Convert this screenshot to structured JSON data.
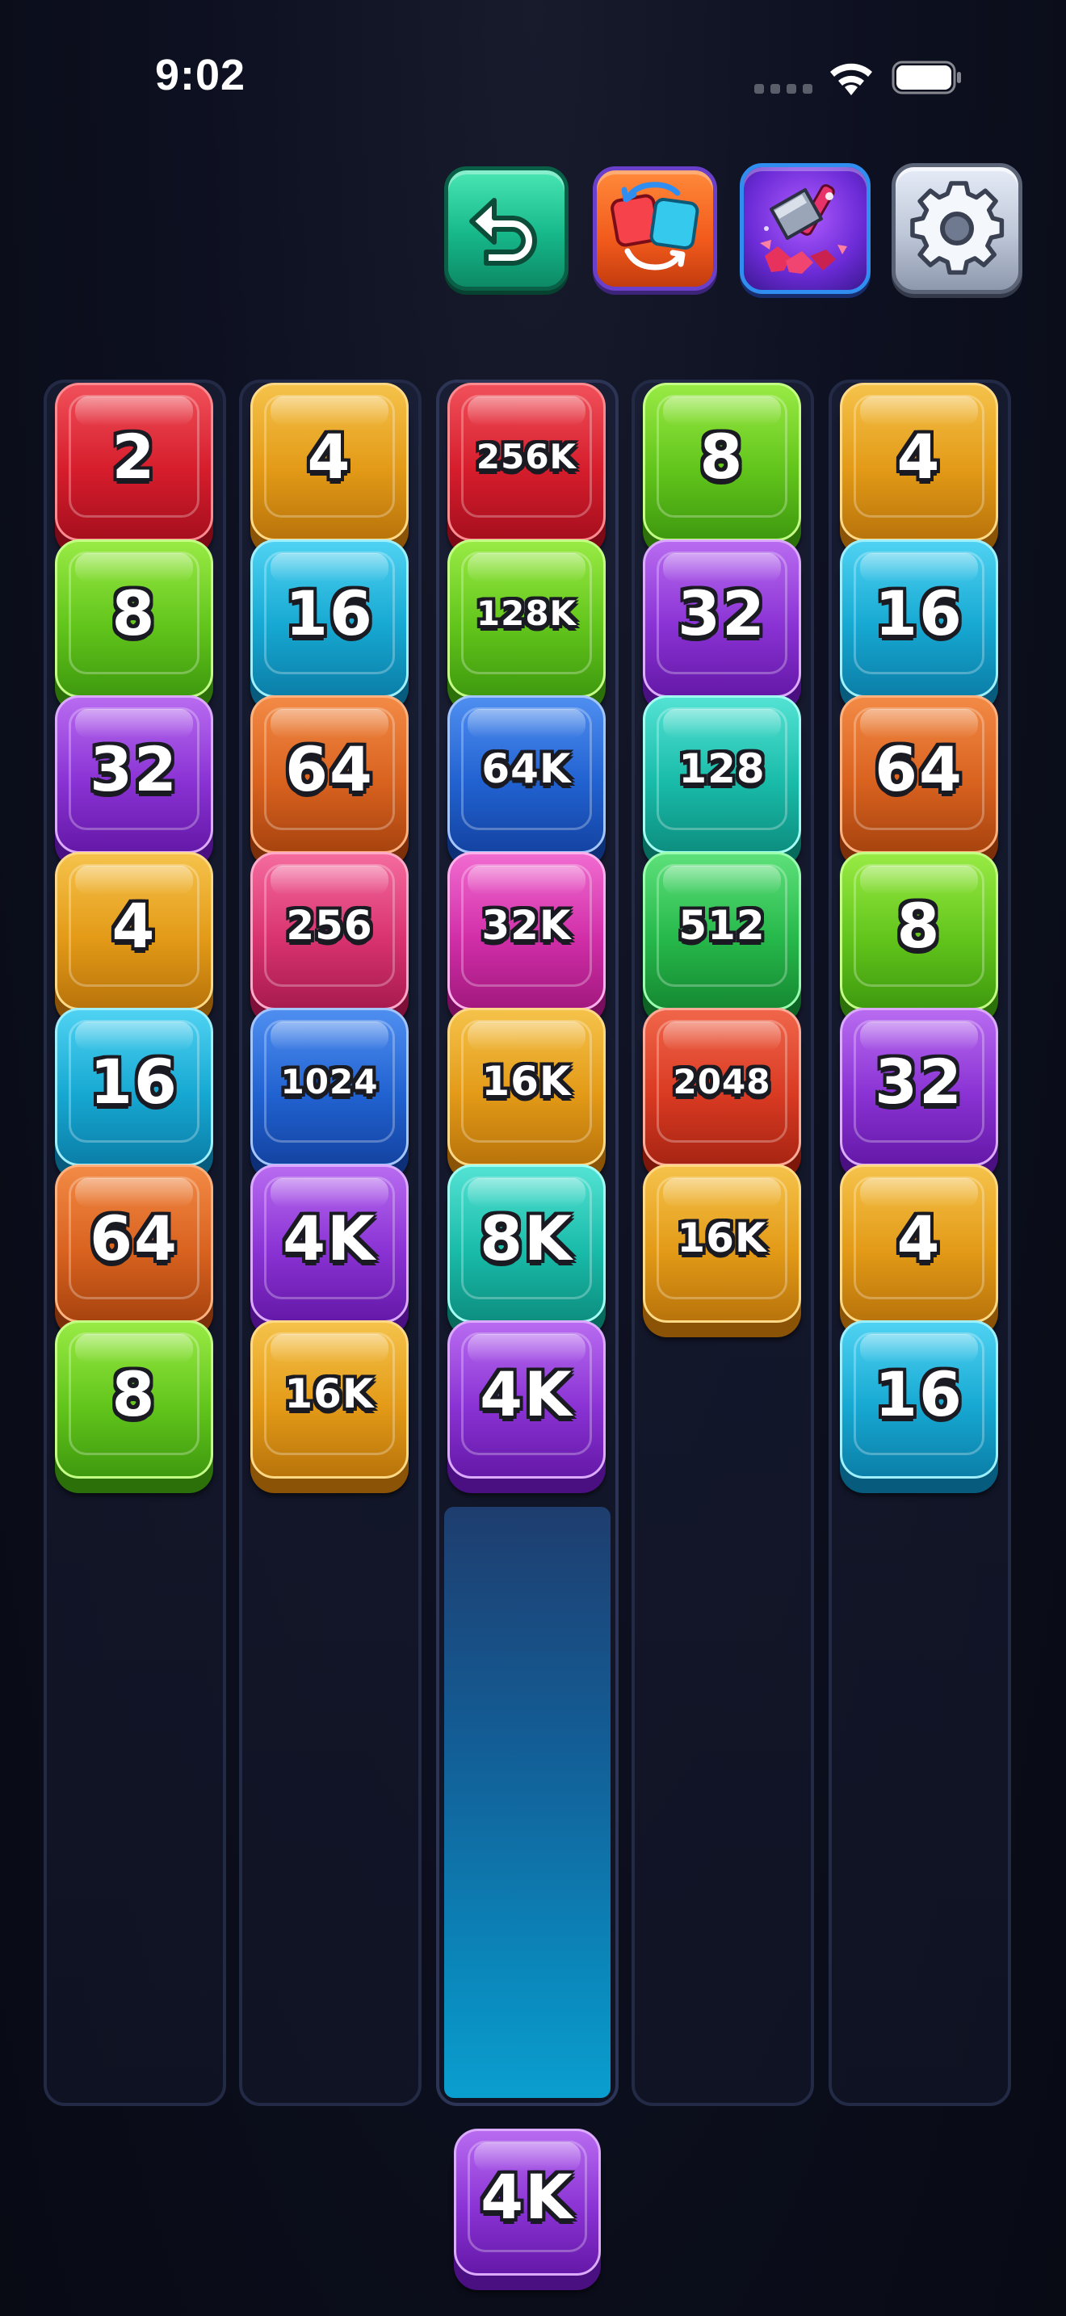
{
  "status_bar": {
    "time": "9:02"
  },
  "toolbar": [
    {
      "id": "undo",
      "icon": "undo-arrow-icon"
    },
    {
      "id": "swap",
      "icon": "swap-tiles-icon"
    },
    {
      "id": "hammer",
      "icon": "hammer-icon"
    },
    {
      "id": "settings",
      "icon": "gear-icon"
    }
  ],
  "columns": [
    {
      "tiles": [
        {
          "label": "2",
          "color": "red"
        },
        {
          "label": "8",
          "color": "lime"
        },
        {
          "label": "32",
          "color": "purple"
        },
        {
          "label": "4",
          "color": "orange"
        },
        {
          "label": "16",
          "color": "cyan"
        },
        {
          "label": "64",
          "color": "burnt"
        },
        {
          "label": "8",
          "color": "lime"
        }
      ]
    },
    {
      "tiles": [
        {
          "label": "4",
          "color": "orange"
        },
        {
          "label": "16",
          "color": "cyan"
        },
        {
          "label": "64",
          "color": "burnt"
        },
        {
          "label": "256",
          "color": "pink"
        },
        {
          "label": "1024",
          "color": "blue"
        },
        {
          "label": "4K",
          "color": "purple"
        },
        {
          "label": "16K",
          "color": "orange"
        }
      ]
    },
    {
      "active": true,
      "tiles": [
        {
          "label": "256K",
          "color": "red"
        },
        {
          "label": "128K",
          "color": "lime"
        },
        {
          "label": "64K",
          "color": "blue"
        },
        {
          "label": "32K",
          "color": "magenta"
        },
        {
          "label": "16K",
          "color": "orange"
        },
        {
          "label": "8K",
          "color": "teal"
        },
        {
          "label": "4K",
          "color": "purple"
        }
      ]
    },
    {
      "tiles": [
        {
          "label": "8",
          "color": "lime"
        },
        {
          "label": "32",
          "color": "purple"
        },
        {
          "label": "128",
          "color": "teal"
        },
        {
          "label": "512",
          "color": "green"
        },
        {
          "label": "2048",
          "color": "scarlet"
        },
        {
          "label": "16K",
          "color": "orange"
        }
      ]
    },
    {
      "tiles": [
        {
          "label": "4",
          "color": "orange"
        },
        {
          "label": "16",
          "color": "cyan"
        },
        {
          "label": "64",
          "color": "burnt"
        },
        {
          "label": "8",
          "color": "lime"
        },
        {
          "label": "32",
          "color": "purple"
        },
        {
          "label": "4",
          "color": "orange"
        },
        {
          "label": "16",
          "color": "cyan"
        }
      ]
    }
  ],
  "next_tile": {
    "label": "4K",
    "color": "purple"
  },
  "colors": {
    "red": "#d61d2c",
    "orange": "#e39a17",
    "burnt": "#d9621f",
    "lime": "#62c51b",
    "green": "#26b84a",
    "cyan": "#16a8d2",
    "teal": "#19bba9",
    "purple": "#8a32d4",
    "pink": "#d9336f",
    "magenta": "#d12ea8",
    "blue": "#2162d1",
    "scarlet": "#d93a22",
    "active_column_glow": "#0aa6d8",
    "background": "#0d1020"
  }
}
